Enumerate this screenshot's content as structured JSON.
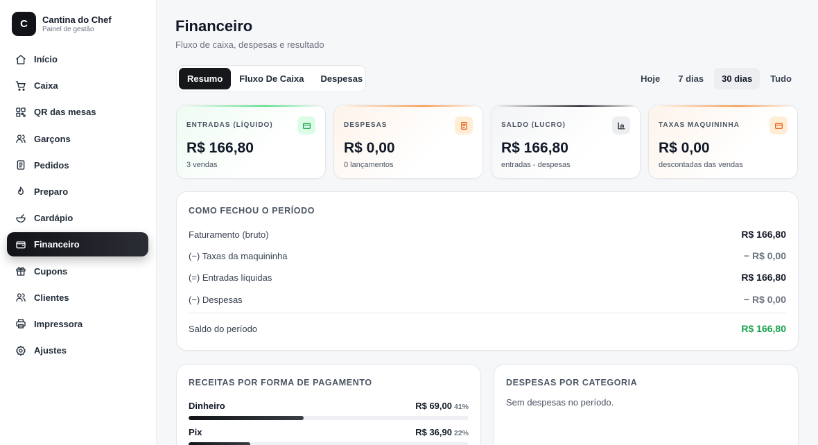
{
  "brand": {
    "initial": "C",
    "name": "Cantina do Chef",
    "subtitle": "Painel de gestão"
  },
  "nav": [
    {
      "label": "Início",
      "icon": "home-icon"
    },
    {
      "label": "Caixa",
      "icon": "cart-icon"
    },
    {
      "label": "QR das mesas",
      "icon": "qr-icon"
    },
    {
      "label": "Garçons",
      "icon": "users-icon"
    },
    {
      "label": "Pedidos",
      "icon": "receipt-icon"
    },
    {
      "label": "Preparo",
      "icon": "flame-icon"
    },
    {
      "label": "Cardápio",
      "icon": "bowl-icon"
    },
    {
      "label": "Financeiro",
      "icon": "wallet-icon",
      "active": true
    },
    {
      "label": "Cupons",
      "icon": "gift-icon"
    },
    {
      "label": "Clientes",
      "icon": "users-icon"
    },
    {
      "label": "Impressora",
      "icon": "printer-icon"
    },
    {
      "label": "Ajustes",
      "icon": "gear-icon"
    }
  ],
  "header": {
    "title": "Financeiro",
    "subtitle": "Fluxo de caixa, despesas e resultado"
  },
  "tabs": [
    {
      "label": "Resumo",
      "active": true
    },
    {
      "label": "Fluxo De Caixa"
    },
    {
      "label": "Despesas"
    }
  ],
  "periods": [
    {
      "label": "Hoje"
    },
    {
      "label": "7 dias"
    },
    {
      "label": "30 dias",
      "active": true
    },
    {
      "label": "Tudo"
    }
  ],
  "kpis": [
    {
      "label": "ENTRADAS (LÍQUIDO)",
      "value": "R$ 166,80",
      "note": "3 vendas",
      "icon": "wallet-icon",
      "accent": "#22c55e"
    },
    {
      "label": "DESPESAS",
      "value": "R$ 0,00",
      "note": "0 lançamentos",
      "icon": "receipt-icon",
      "accent": "#f97316"
    },
    {
      "label": "SALDO (LUCRO)",
      "value": "R$ 166,80",
      "note": "entradas - despesas",
      "icon": "chart-icon",
      "accent": "#111318"
    },
    {
      "label": "TAXAS MAQUININHA",
      "value": "R$ 0,00",
      "note": "descontadas das vendas",
      "icon": "card-icon",
      "accent": "#f97316"
    }
  ],
  "summary": {
    "title": "COMO FECHOU O PERÍODO",
    "rows": [
      {
        "label": "Faturamento (bruto)",
        "value": "R$ 166,80"
      },
      {
        "label": "(−) Taxas da maquininha",
        "value": "− R$ 0,00"
      },
      {
        "label": "(=) Entradas líquidas",
        "value": "R$ 166,80"
      },
      {
        "label": "(−) Despesas",
        "value": "− R$ 0,00"
      }
    ],
    "result": {
      "label": "Saldo do período",
      "value": "R$ 166,80"
    }
  },
  "payments": {
    "title": "RECEITAS POR FORMA DE PAGAMENTO",
    "items": [
      {
        "name": "Dinheiro",
        "amount": "R$ 69,00",
        "pct": "41%",
        "share": 0.41
      },
      {
        "name": "Pix",
        "amount": "R$ 36,90",
        "pct": "22%",
        "share": 0.22
      }
    ]
  },
  "expenses": {
    "title": "DESPESAS POR CATEGORIA",
    "empty": "Sem despesas no período."
  },
  "colors": {
    "positive": "#16a34a",
    "dark": "#111318"
  }
}
